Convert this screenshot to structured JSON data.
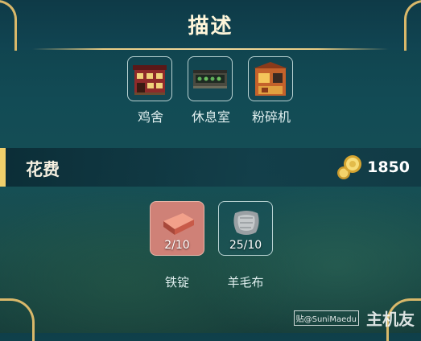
{
  "header": {
    "title": "描述"
  },
  "buildings": [
    {
      "label": "鸡舍",
      "icon": "chicken-coop-icon"
    },
    {
      "label": "休息室",
      "icon": "lounge-icon"
    },
    {
      "label": "粉碎机",
      "icon": "crusher-icon"
    }
  ],
  "cost": {
    "label": "花费",
    "amount": "1850",
    "icon": "gold-coin-icon"
  },
  "materials": [
    {
      "label": "铁锭",
      "count": "2/10",
      "icon": "iron-ingot-icon",
      "highlight_color": "#cf8177"
    },
    {
      "label": "羊毛布",
      "count": "25/10",
      "icon": "wool-cloth-icon"
    }
  ],
  "watermark": {
    "site": "贴@SuniMaedu",
    "brand": "主机友"
  },
  "colors": {
    "accent_gold": "#f1cf6b",
    "panel_teal": "#124b55",
    "border_light": "#b9d3d3"
  }
}
